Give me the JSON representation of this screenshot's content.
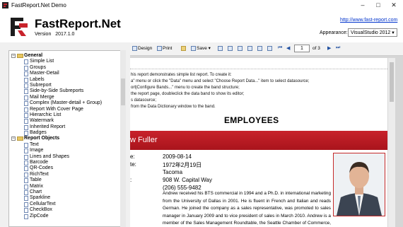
{
  "window": {
    "title": "FastReport.Net Demo"
  },
  "header": {
    "product": "FastReport.Net",
    "version_label": "Version",
    "version": "2017.1.0",
    "website": "http://www.fast-report.com",
    "appearance_label": "Appearance:",
    "appearance_value": "VisualStudio 2012"
  },
  "tree": {
    "groups": [
      {
        "label": "General",
        "items": [
          "Simple List",
          "Groups",
          "Master-Detail",
          "Labels",
          "Subreport",
          "Side-by-Side Subreports",
          "Mail Merge",
          "Complex (Master-detail + Group)",
          "Report With Cover Page",
          "Hierarchic List",
          "Watermark",
          "Inherited Report",
          "Badges"
        ]
      },
      {
        "label": "Report Objects",
        "items": [
          "Text",
          "Image",
          "Lines and Shapes",
          "Barcode",
          "QR-Codes",
          "RichText",
          "Table",
          "Matrix",
          "Chart",
          "Sparkline",
          "CellularText",
          "CheckBox",
          "ZipCode"
        ]
      }
    ]
  },
  "toolbar": {
    "design": "Design",
    "print": "Print",
    "save": "Save",
    "page_value": "1",
    "page_of": "of 3"
  },
  "report": {
    "description": [
      "his report demonstrates simple list report. To create it:",
      "a\" menu or click the \"Data\" menu and select \"Choose Report Data...\" item to select datasource;",
      "ort|Configure Bands...\" menu to create the band structure;",
      "the report page, doubleclick the data band to show its editor;",
      "s datasource;",
      "from the Data Dictionary window to the band."
    ],
    "heading": "EMPLOYEES",
    "employee_name": "w Fuller",
    "fields": [
      {
        "label": "e:",
        "value": "2009-08-14"
      },
      {
        "label": "te:",
        "value": "1972年2月19日"
      },
      {
        "label": "",
        "value": "Tacoma"
      },
      {
        "label": ":",
        "value": "908 W. Capital Way"
      },
      {
        "label": "",
        "value": "(206) 555-9482"
      }
    ],
    "bio": "Andrew received his BTS commercial in 1994 and a Ph.D. in international marketing from the University of Dallas in 2001. He is fluent in French and Italian and reads German. He joined the company as a sales representative, was promoted to sales manager in January 2009 and to vice president of sales in March 2010. Andrew is a member of the Sales Management Roundtable, the Seattle Chamber of Commerce, and the Pacific Rim Importers Association."
  },
  "colors": {
    "accent_red": "#b3161f",
    "link_blue": "#0033cc"
  }
}
